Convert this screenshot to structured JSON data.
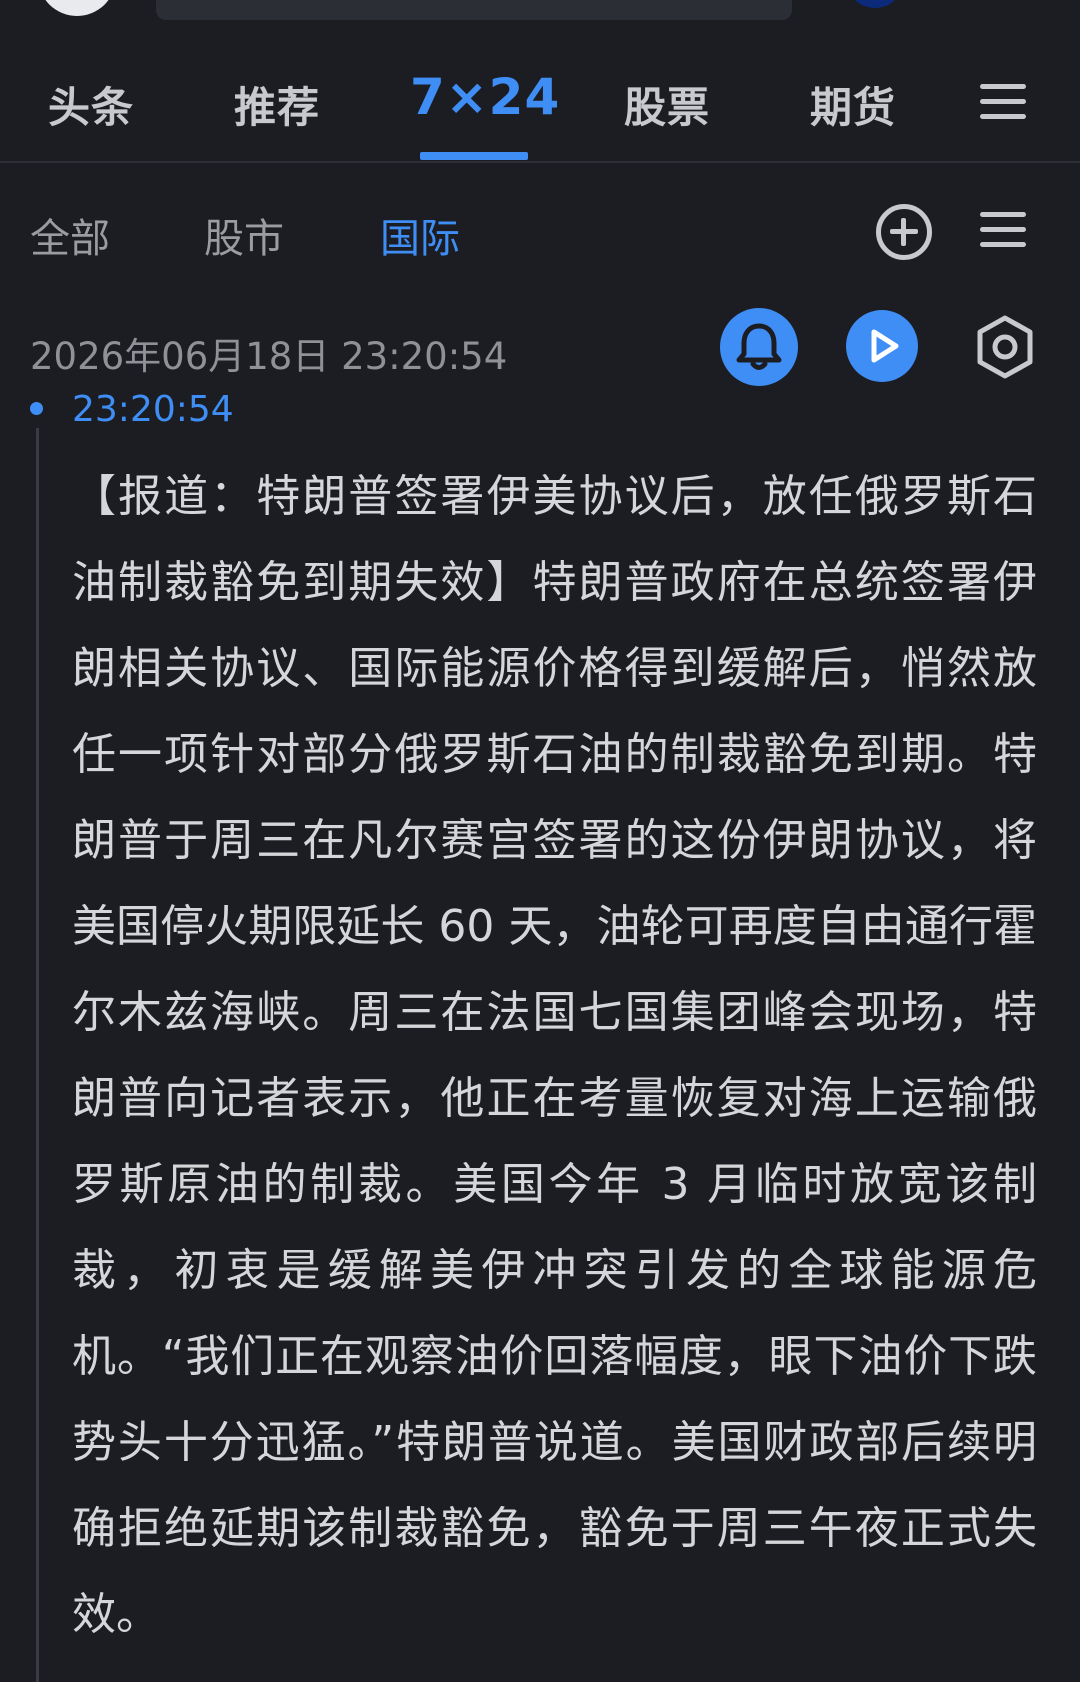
{
  "main_tabs": [
    {
      "label": "头条"
    },
    {
      "label": "推荐"
    },
    {
      "label": "7×24"
    },
    {
      "label": "股票"
    },
    {
      "label": "期货"
    }
  ],
  "sub_tabs": [
    {
      "label": "全部"
    },
    {
      "label": "股市"
    },
    {
      "label": "国际"
    }
  ],
  "feed": {
    "date": "2026年06月18日 23:20:54",
    "item": {
      "time": "23:20:54",
      "content": "【报道：特朗普签署伊美协议后，放任俄罗斯石油制裁豁免到期失效】特朗普政府在总统签署伊朗相关协议、国际能源价格得到缓解后，悄然放任一项针对部分俄罗斯石油的制裁豁免到期。特朗普于周三在凡尔赛宫签署的这份伊朗协议，将美国停火期限延长 60 天，油轮可再度自由通行霍尔木兹海峡。周三在法国七国集团峰会现场，特朗普向记者表示，他正在考量恢复对海上运输俄罗斯原油的制裁。美国今年 3 月临时放宽该制裁，初衷是缓解美伊冲突引发的全球能源危机。“我们正在观察油价回落幅度，眼下油价下跌势头十分迅猛。”特朗普说道。美国财政部后续明确拒绝延期该制裁豁免，豁免于周三午夜正式失效。"
    }
  },
  "colors": {
    "background": "#1c1d22",
    "accent": "#3f8ef5",
    "text": "#d5d6da",
    "muted_text": "#9a9ca2"
  },
  "icons": [
    "menu-icon",
    "add-circle-icon",
    "bell-icon",
    "play-icon",
    "settings-icon"
  ]
}
